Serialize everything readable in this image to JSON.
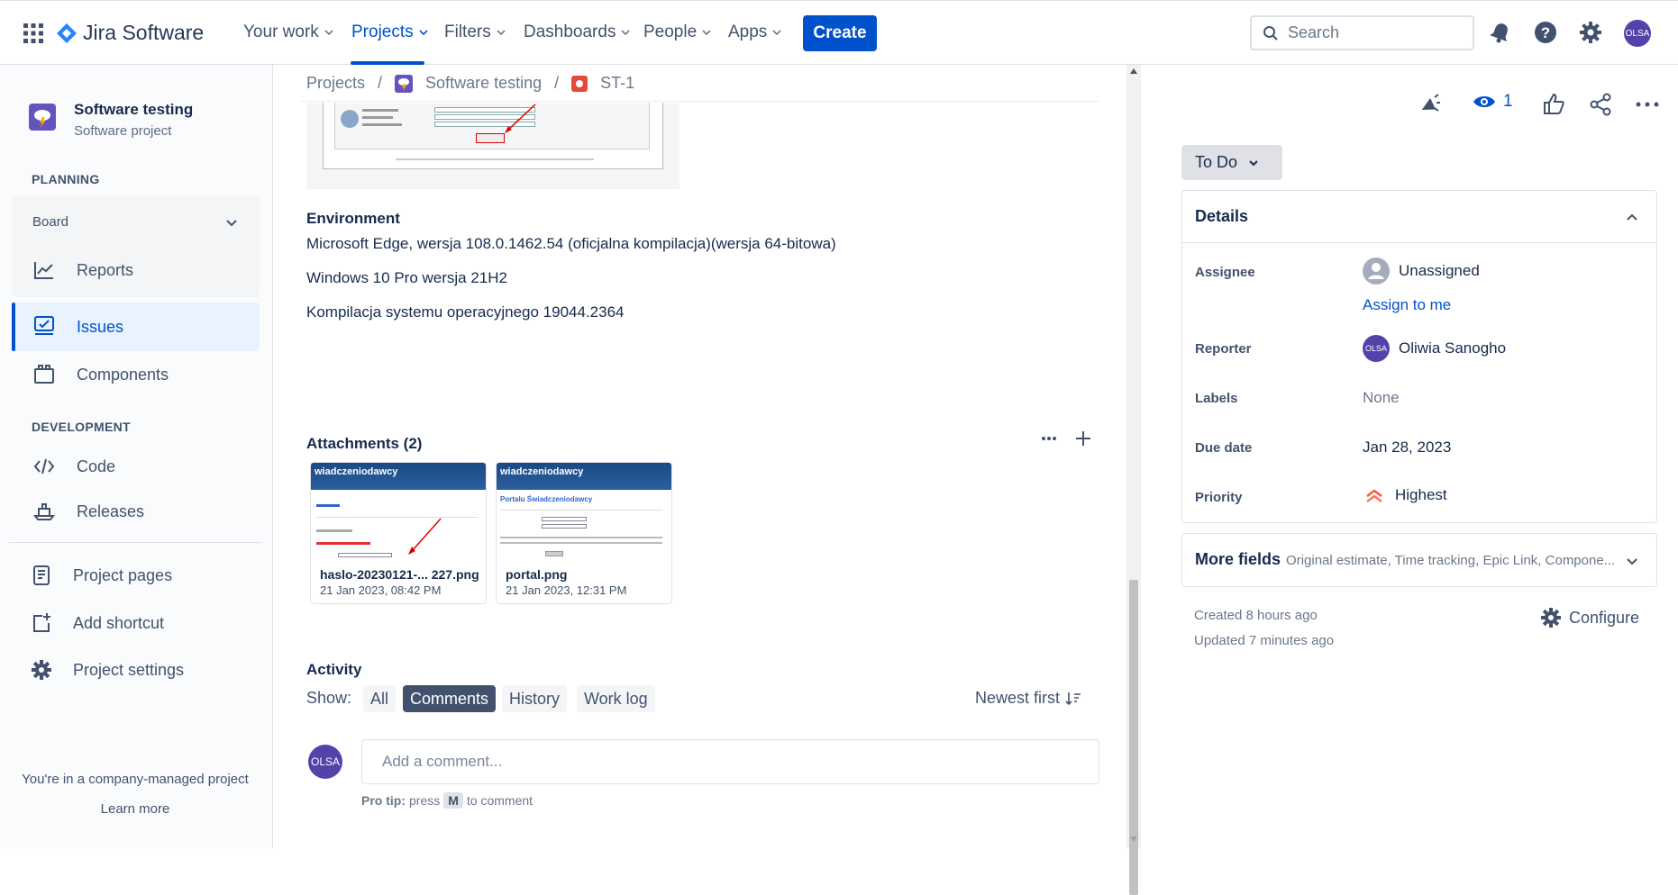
{
  "topnav": {
    "brand": "Jira Software",
    "items": [
      {
        "label": "Your work"
      },
      {
        "label": "Projects"
      },
      {
        "label": "Filters"
      },
      {
        "label": "Dashboards"
      },
      {
        "label": "People"
      },
      {
        "label": "Apps"
      }
    ],
    "create_label": "Create",
    "search_placeholder": "Search",
    "user_initials": "OLSA"
  },
  "sidebar": {
    "project_name": "Software testing",
    "project_type": "Software project",
    "planning_label": "PLANNING",
    "board_label": "Board",
    "reports_label": "Reports",
    "issues_label": "Issues",
    "components_label": "Components",
    "development_label": "DEVELOPMENT",
    "code_label": "Code",
    "releases_label": "Releases",
    "project_pages_label": "Project pages",
    "add_shortcut_label": "Add shortcut",
    "project_settings_label": "Project settings",
    "footer_text": "You're in a company-managed project",
    "learn_more": "Learn more"
  },
  "breadcrumb": {
    "projects": "Projects",
    "project": "Software testing",
    "issue": "ST-1"
  },
  "main": {
    "environment_heading": "Environment",
    "env_lines": [
      "Microsoft Edge, wersja 108.0.1462.54 (oficjalna kompilacja)(wersja 64-bitowa)",
      "Windows 10 Pro wersja 21H2",
      "Kompilacja systemu operacyjnego 19044.2364"
    ],
    "attachments_heading": "Attachments (2)",
    "attachments": [
      {
        "name": "haslo-20230121-... 227.png",
        "date": "21 Jan 2023, 08:42 PM",
        "preview_header": "wiadczeniodawcy"
      },
      {
        "name": "portal.png",
        "date": "21 Jan 2023, 12:31 PM",
        "preview_header": "wiadczeniodawcy",
        "preview_sub": "Portalu Świadczeniodawcy"
      }
    ],
    "activity_heading": "Activity",
    "show_label": "Show:",
    "tabs": [
      "All",
      "Comments",
      "History",
      "Work log"
    ],
    "sort_label": "Newest first",
    "comment_placeholder": "Add a comment...",
    "pro_tip_bold": "Pro tip:",
    "pro_tip_press": "press",
    "pro_tip_key": "M",
    "pro_tip_suffix": "to comment",
    "commenter_initials": "OLSA"
  },
  "rightpanel": {
    "watch_count": "1",
    "status": "To Do",
    "details_heading": "Details",
    "assignee_label": "Assignee",
    "assignee_value": "Unassigned",
    "assign_to_me": "Assign to me",
    "reporter_label": "Reporter",
    "reporter_value": "Oliwia Sanogho",
    "reporter_initials": "OLSA",
    "labels_label": "Labels",
    "labels_value": "None",
    "due_label": "Due date",
    "due_value": "Jan 28, 2023",
    "priority_label": "Priority",
    "priority_value": "Highest",
    "more_fields_label": "More fields",
    "more_fields_sub": "Original estimate, Time tracking, Epic Link, Compone...",
    "created": "Created 8 hours ago",
    "updated": "Updated 7 minutes ago",
    "configure": "Configure"
  },
  "colors": {
    "primary": "#0052cc",
    "sidebar_bg": "#fafbfc",
    "selected_bg": "#e9f2ff",
    "avatar": "#5243aa",
    "priority": "#ff5630"
  }
}
